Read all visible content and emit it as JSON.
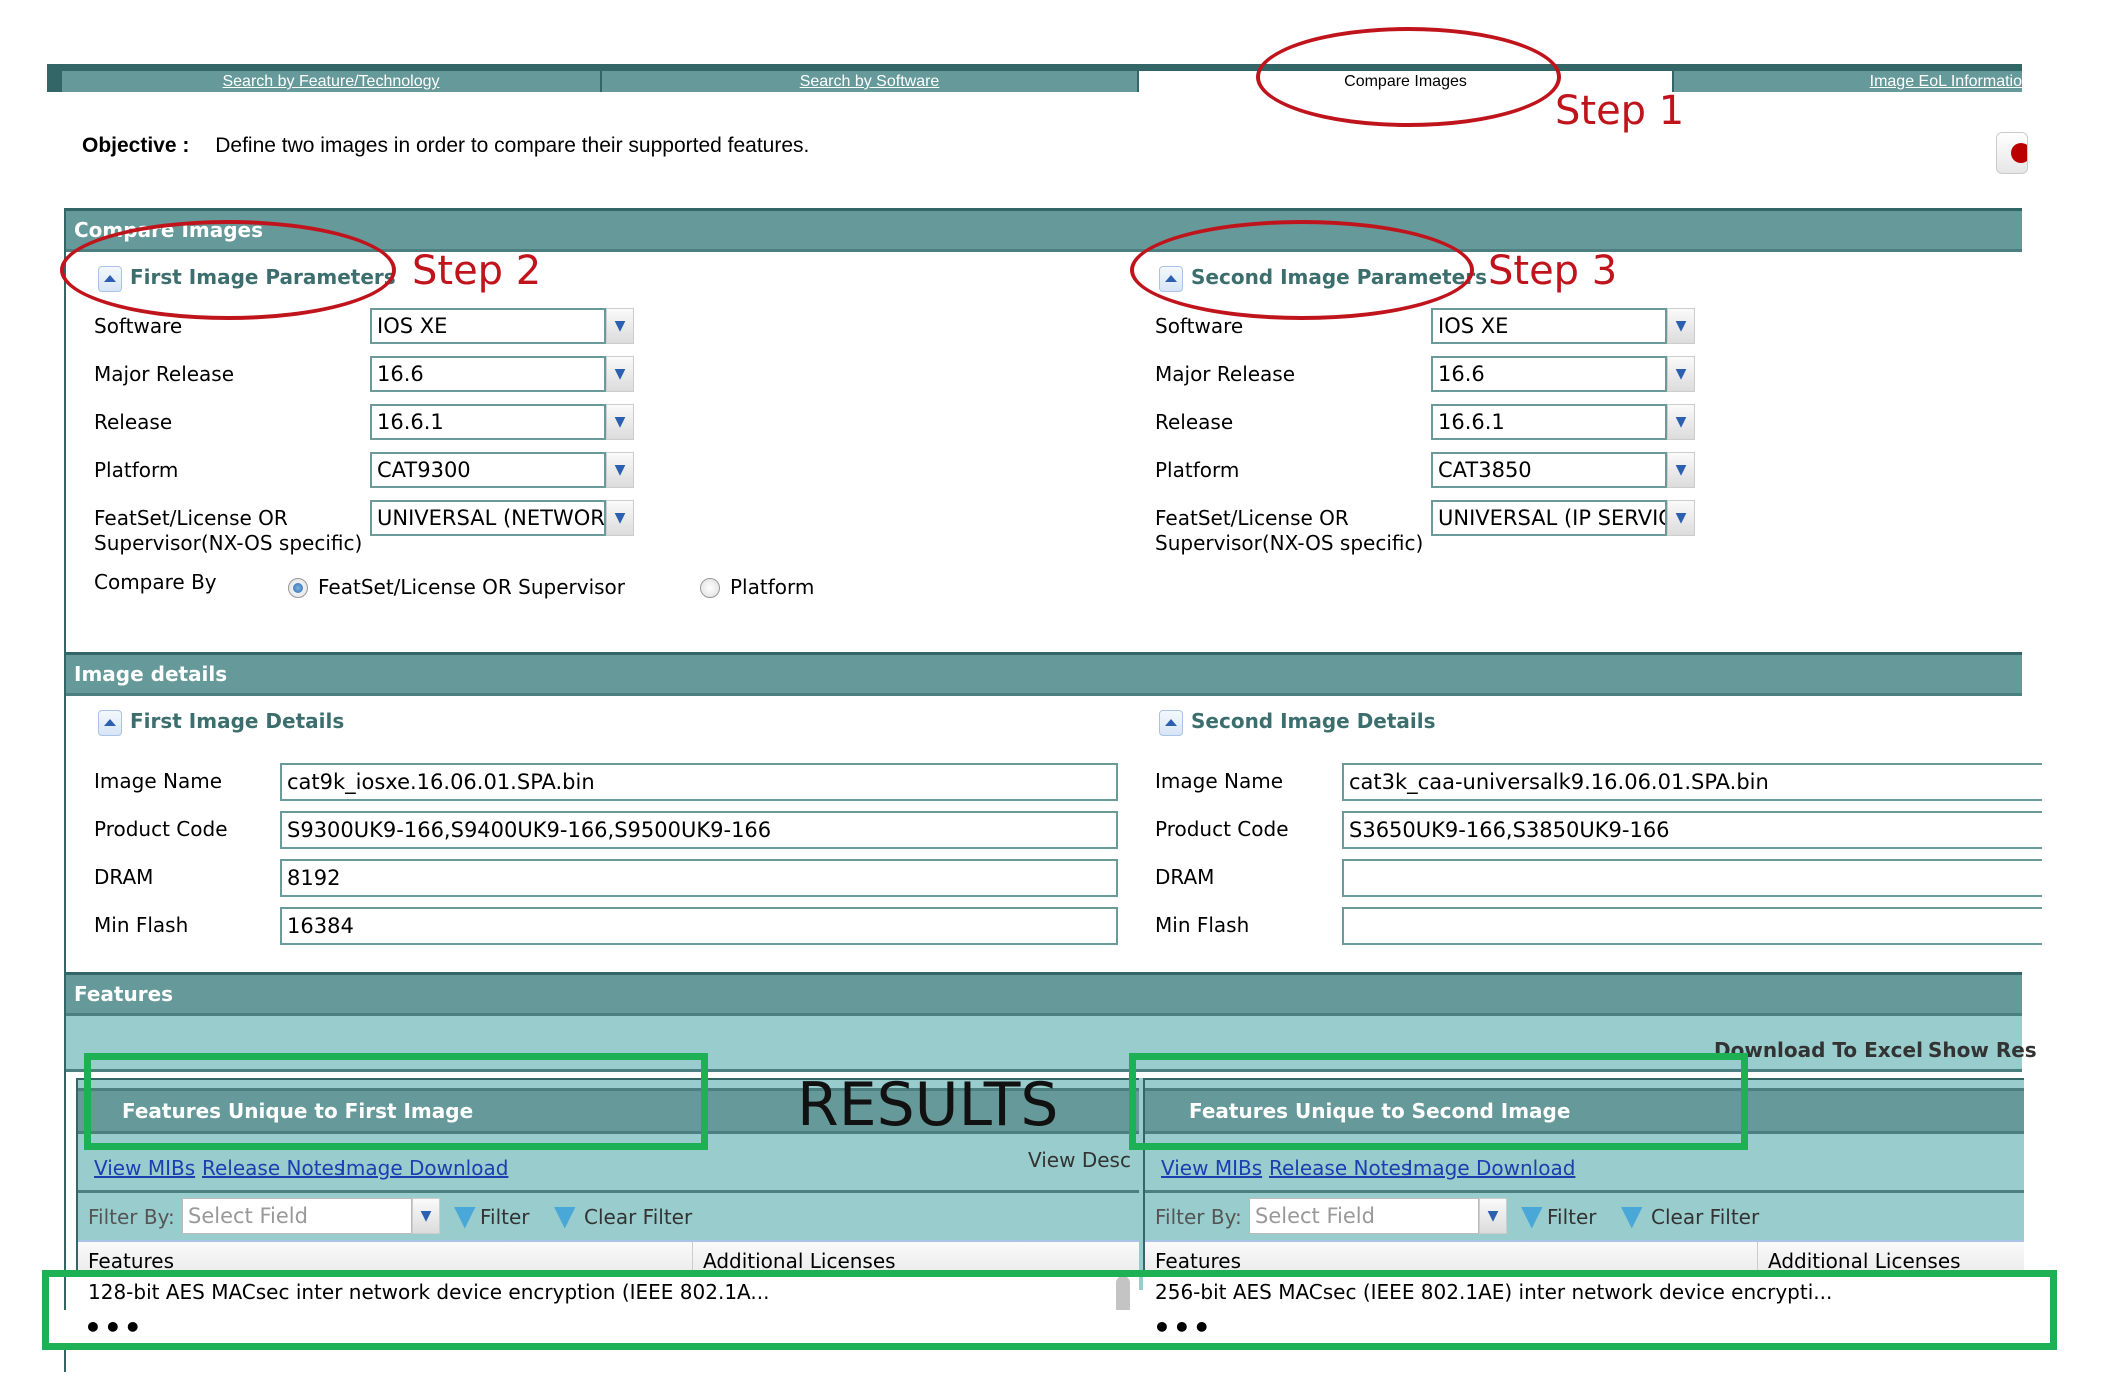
{
  "tabs": [
    {
      "label": "Search by Feature/Technology",
      "active": false
    },
    {
      "label": "Search by Software",
      "active": false
    },
    {
      "label": "Compare Images",
      "active": true
    },
    {
      "label": "Image EoL Informatio",
      "active": false
    }
  ],
  "objective": {
    "label": "Objective :",
    "text": "Define two images in order to compare their supported features."
  },
  "compare_section": {
    "title": "Compare Images",
    "first": {
      "title": "First Image Parameters",
      "fields": [
        {
          "label": "Software",
          "value": "IOS XE"
        },
        {
          "label": "Major Release",
          "value": "16.6"
        },
        {
          "label": "Release",
          "value": "16.6.1"
        },
        {
          "label": "Platform",
          "value": "CAT9300"
        },
        {
          "label": "FeatSet/License OR Supervisor(NX-OS specific)",
          "label_line1": "FeatSet/License OR",
          "label_line2": "Supervisor(NX-OS specific)",
          "value": "UNIVERSAL (NETWORK"
        }
      ],
      "compare_by": {
        "label": "Compare By",
        "options": [
          {
            "label": "FeatSet/License OR Supervisor",
            "selected": true
          },
          {
            "label": "Platform",
            "selected": false
          }
        ]
      }
    },
    "second": {
      "title": "Second Image Parameters",
      "fields": [
        {
          "label": "Software",
          "value": "IOS XE"
        },
        {
          "label": "Major Release",
          "value": "16.6"
        },
        {
          "label": "Release",
          "value": "16.6.1"
        },
        {
          "label": "Platform",
          "value": "CAT3850"
        },
        {
          "label": "FeatSet/License OR Supervisor(NX-OS specific)",
          "label_line1": "FeatSet/License OR",
          "label_line2": "Supervisor(NX-OS specific)",
          "value": "UNIVERSAL (IP SERVIC"
        }
      ]
    }
  },
  "details_section": {
    "title": "Image details",
    "first": {
      "title": "First Image Details",
      "fields": [
        {
          "label": "Image Name",
          "value": "cat9k_iosxe.16.06.01.SPA.bin"
        },
        {
          "label": "Product Code",
          "value": "S9300UK9-166,S9400UK9-166,S9500UK9-166"
        },
        {
          "label": "DRAM",
          "value": "8192"
        },
        {
          "label": "Min Flash",
          "value": "16384"
        }
      ]
    },
    "second": {
      "title": "Second Image Details",
      "fields": [
        {
          "label": "Image Name",
          "value": "cat3k_caa-universalk9.16.06.01.SPA.bin"
        },
        {
          "label": "Product Code",
          "value": "S3650UK9-166,S3850UK9-166"
        },
        {
          "label": "DRAM",
          "value": ""
        },
        {
          "label": "Min Flash",
          "value": ""
        }
      ]
    }
  },
  "features_section": {
    "title": "Features",
    "download_excel": "Download To Excel",
    "show_results": "Show Res",
    "view_desc": "View Desc",
    "first": {
      "title": "Features Unique to First Image",
      "links": [
        "View MIBs",
        "Release Notes",
        "Image Download"
      ],
      "filter_label": "Filter By:",
      "filter_placeholder": "Select Field",
      "filter_button": "Filter",
      "clear_filter_button": "Clear Filter",
      "columns": [
        "Features",
        "Additional Licenses"
      ],
      "rows": [
        {
          "feature": "128-bit AES MACsec inter network device encryption (IEEE 802.1A...",
          "licenses": ""
        }
      ]
    },
    "second": {
      "title": "Features Unique to Second Image",
      "links": [
        "View MIBs",
        "Release Notes",
        "Image Download"
      ],
      "filter_label": "Filter By:",
      "filter_placeholder": "Select Field",
      "filter_button": "Filter",
      "clear_filter_button": "Clear Filter",
      "columns": [
        "Features",
        "Additional Licenses"
      ],
      "rows": [
        {
          "feature": "256-bit AES MACsec (IEEE 802.1AE) inter network device encrypti...",
          "licenses": ""
        }
      ]
    }
  },
  "annotations": {
    "step1": "Step 1",
    "step2": "Step 2",
    "step3": "Step 3",
    "results": "RESULTS",
    "ellipsis": "•••",
    "annotation_red": "#c0141c",
    "annotation_green": "#1db054"
  },
  "colors": {
    "header_teal": "#669999",
    "dark_teal": "#336666",
    "light_teal": "#99cccc",
    "link_blue": "#1a3fb0"
  }
}
